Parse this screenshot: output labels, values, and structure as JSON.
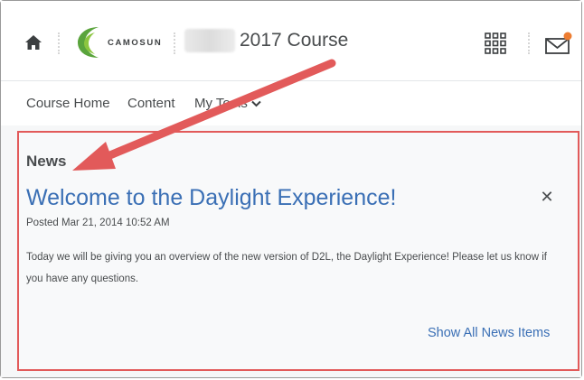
{
  "header": {
    "logo_text": "CAMOSUN",
    "course_title": "2017 Course",
    "icons": {
      "home": "home-icon",
      "apps": "grid-icon",
      "messages": "mail-icon"
    },
    "colors": {
      "logo_green": "#5aa43c",
      "notification_dot": "#ed7d31"
    }
  },
  "nav": {
    "items": [
      {
        "label": "Course Home"
      },
      {
        "label": "Content"
      },
      {
        "label": "My Tools",
        "has_dropdown": true
      }
    ]
  },
  "news": {
    "heading": "News",
    "title": "Welcome to the Daylight Experience!",
    "posted": "Posted Mar 21, 2014 10:52 AM",
    "body": "Today we will be giving you an overview of the new version of D2L, the Daylight Experience!  Please let us know if you have any questions.",
    "dismiss_icon": "close-icon",
    "show_all": "Show All News Items"
  },
  "annotation": {
    "arrow_color": "#e25a5a",
    "highlight_color": "#e25a5a"
  }
}
